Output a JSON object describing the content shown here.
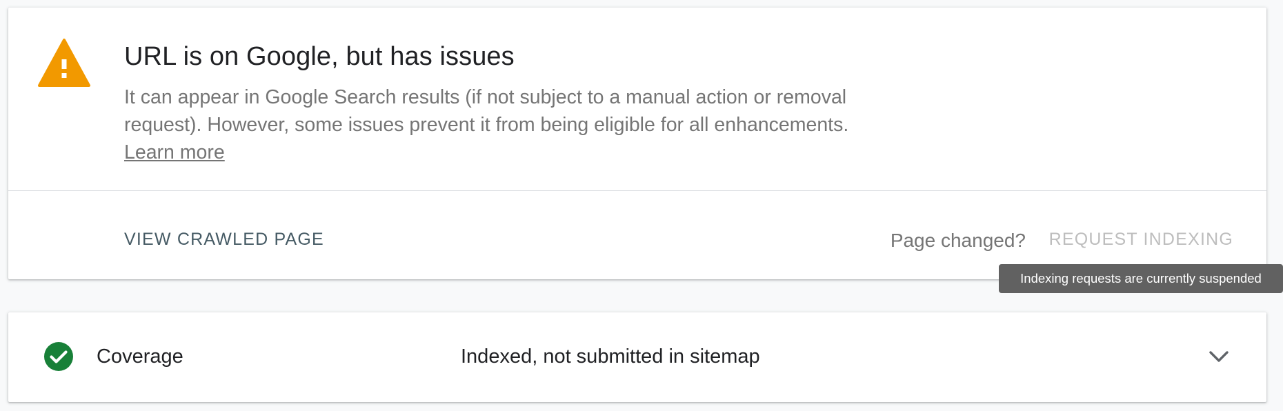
{
  "status": {
    "title": "URL is on Google, but has issues",
    "description": "It can appear in Google Search results (if not subject to a manual action or removal request). However, some issues prevent it from being eligible for all enhancements.",
    "learn_more": "Learn more",
    "icon": "warning-icon"
  },
  "actions": {
    "view_crawled_page": "VIEW CRAWLED PAGE",
    "page_changed": "Page changed?",
    "request_indexing": "REQUEST INDEXING",
    "tooltip": "Indexing requests are currently suspended"
  },
  "coverage": {
    "label": "Coverage",
    "status": "Indexed, not submitted in sitemap",
    "icon": "check-circle-icon"
  },
  "colors": {
    "warning": "#f29900",
    "success": "#188038",
    "primary_text": "#202124",
    "secondary_text": "#757575",
    "button_text": "#455a64",
    "disabled_text": "#bdbdbd",
    "tooltip_bg": "#616161"
  }
}
